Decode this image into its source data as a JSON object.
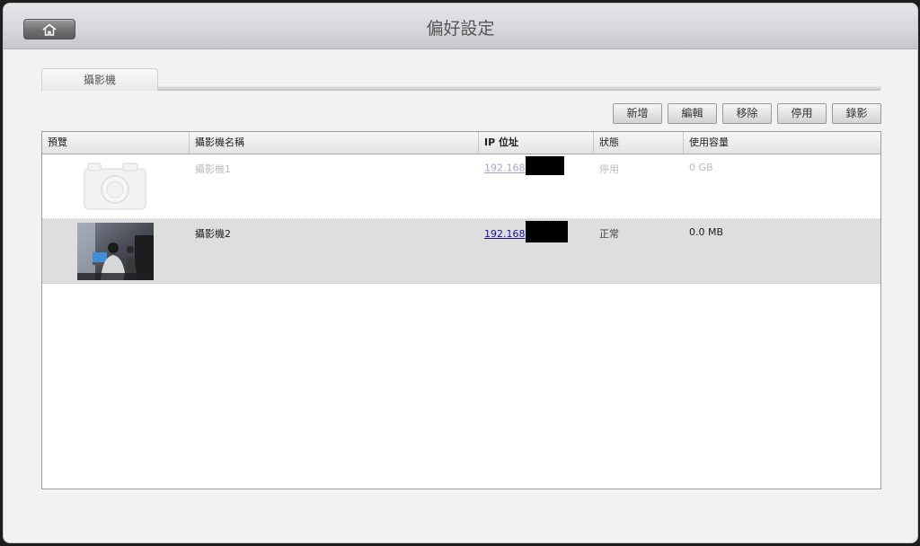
{
  "header": {
    "title": "偏好設定",
    "home_icon": "home-icon"
  },
  "tabs": [
    {
      "label": "攝影機",
      "active": true
    }
  ],
  "toolbar": {
    "add": "新增",
    "edit": "編輯",
    "remove": "移除",
    "disable": "停用",
    "record": "錄影"
  },
  "table": {
    "columns": {
      "preview": "預覽",
      "name": "攝影機名稱",
      "ip": "IP 位址",
      "status": "狀態",
      "usage": "使用容量"
    },
    "rows": [
      {
        "name": "攝影機1",
        "ip": "192.168",
        "status": "停用",
        "usage": "0 GB",
        "preview": "camera-placeholder-icon",
        "enabled": false,
        "selected": false
      },
      {
        "name": "攝影機2",
        "ip": "192.168",
        "status": "正常",
        "usage": "0.0 MB",
        "preview": "camera-snapshot",
        "enabled": true,
        "selected": true
      }
    ]
  },
  "colors": {
    "link": "#1a0dab",
    "selected_row": "#dedede",
    "disabled_text": "#bcbcbc"
  }
}
